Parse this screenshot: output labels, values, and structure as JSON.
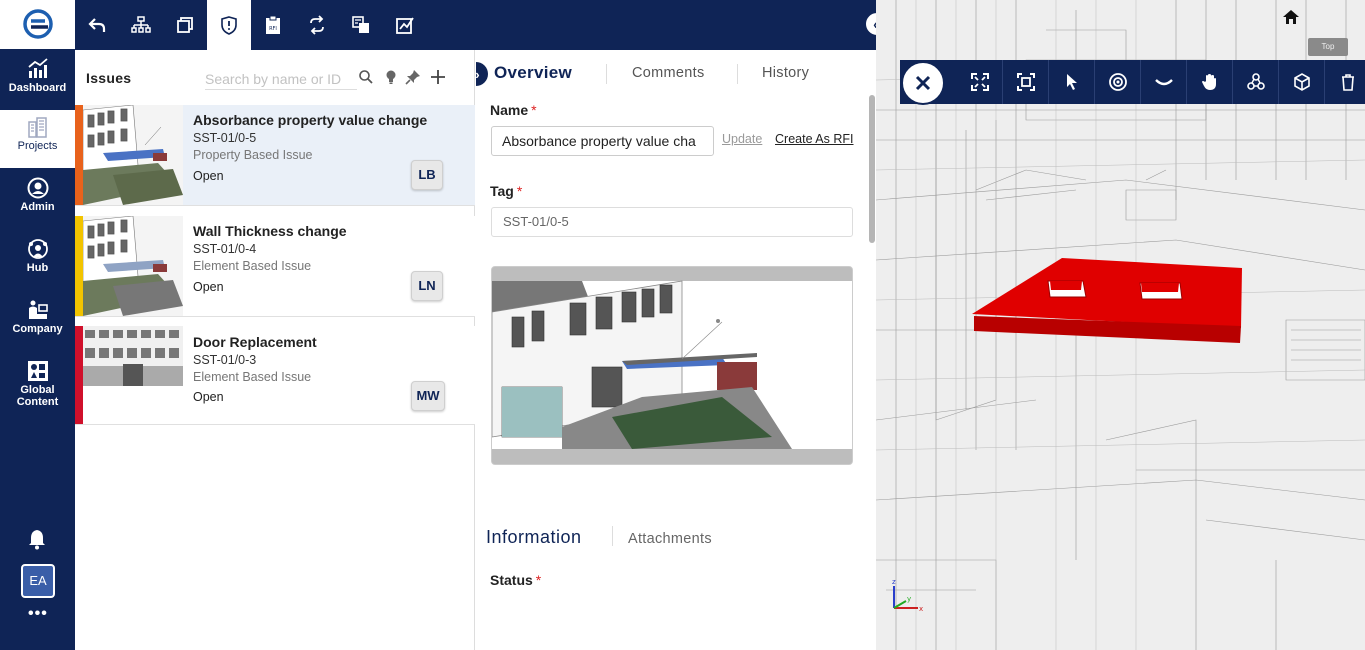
{
  "nav": {
    "items": [
      {
        "label": "Dashboard",
        "icon": "chart-icon"
      },
      {
        "label": "Projects",
        "icon": "buildings-icon"
      },
      {
        "label": "Admin",
        "icon": "user-circle-icon"
      },
      {
        "label": "Hub",
        "icon": "hub-icon"
      },
      {
        "label": "Company",
        "icon": "company-icon"
      },
      {
        "label": "Global Content",
        "icon": "global-content-icon"
      }
    ],
    "avatar_initials": "EA",
    "more_label": "•••"
  },
  "issues": {
    "title": "Issues",
    "search_placeholder": "Search by name or ID",
    "list": [
      {
        "name": "Absorbance property value change",
        "tag": "SST-01/0-5",
        "type": "Property Based Issue",
        "status": "Open",
        "assignee": "LB",
        "color": "#e8621c"
      },
      {
        "name": "Wall Thickness change",
        "tag": "SST-01/0-4",
        "type": "Element Based Issue",
        "status": "Open",
        "assignee": "LN",
        "color": "#f2c400"
      },
      {
        "name": "Door Replacement",
        "tag": "SST-01/0-3",
        "type": "Element Based Issue",
        "status": "Open",
        "assignee": "MW",
        "color": "#d0102b"
      }
    ]
  },
  "detail": {
    "tabs": [
      "Overview",
      "Comments",
      "History"
    ],
    "name_label": "Name",
    "name_value": "Absorbance property value cha",
    "update_label": "Update",
    "rfi_label": "Create As RFI",
    "tag_label": "Tag",
    "tag_value": "SST-01/0-5",
    "required_mark": "*",
    "section_tabs": [
      "Information",
      "Attachments"
    ],
    "status_label": "Status"
  },
  "viewer": {
    "cube_label": "Top",
    "axis_labels": {
      "x": "x",
      "y": "y",
      "z": "z"
    }
  },
  "colors": {
    "navy": "#0f2456",
    "accent_red": "#d20000"
  }
}
